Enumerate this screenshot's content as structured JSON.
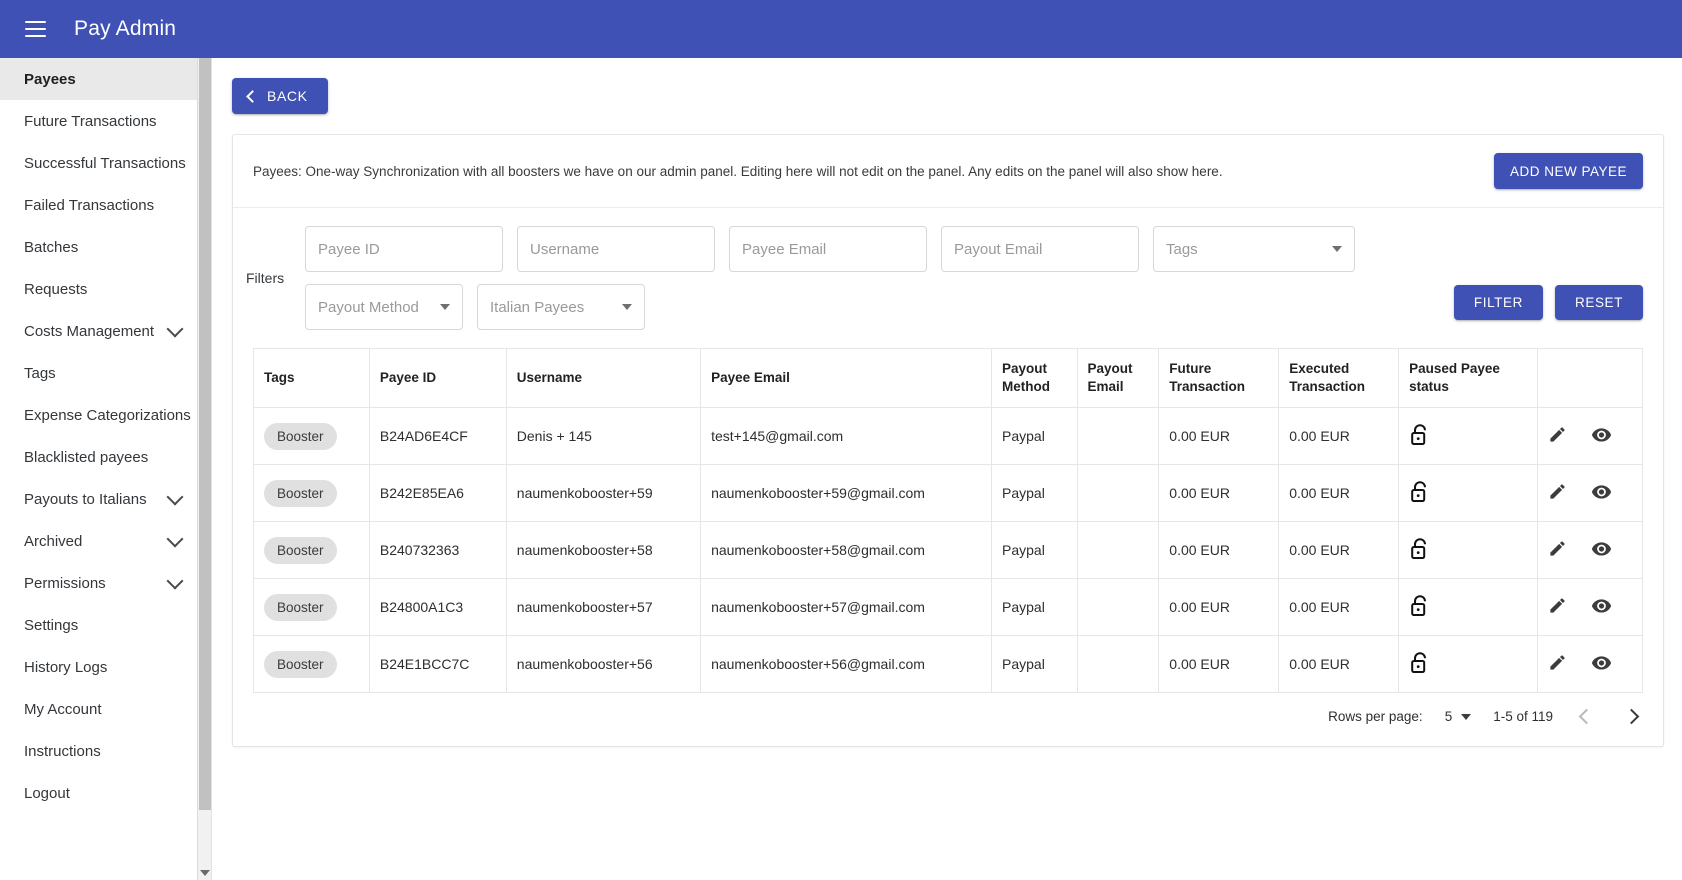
{
  "appbar": {
    "title": "Pay Admin",
    "menu_icon": "hamburger-menu-icon"
  },
  "sidebar": {
    "items": [
      {
        "label": "Payees",
        "active": true,
        "expandable": false
      },
      {
        "label": "Future Transactions",
        "active": false,
        "expandable": false
      },
      {
        "label": "Successful Transactions",
        "active": false,
        "expandable": false
      },
      {
        "label": "Failed Transactions",
        "active": false,
        "expandable": false
      },
      {
        "label": "Batches",
        "active": false,
        "expandable": false
      },
      {
        "label": "Requests",
        "active": false,
        "expandable": false
      },
      {
        "label": "Costs Management",
        "active": false,
        "expandable": true
      },
      {
        "label": "Tags",
        "active": false,
        "expandable": false
      },
      {
        "label": "Expense Categorizations",
        "active": false,
        "expandable": false
      },
      {
        "label": "Blacklisted payees",
        "active": false,
        "expandable": false
      },
      {
        "label": "Payouts to Italians",
        "active": false,
        "expandable": true
      },
      {
        "label": "Archived",
        "active": false,
        "expandable": true
      },
      {
        "label": "Permissions",
        "active": false,
        "expandable": true
      },
      {
        "label": "Settings",
        "active": false,
        "expandable": false
      },
      {
        "label": "History Logs",
        "active": false,
        "expandable": false
      },
      {
        "label": "My Account",
        "active": false,
        "expandable": false
      },
      {
        "label": "Instructions",
        "active": false,
        "expandable": false
      },
      {
        "label": "Logout",
        "active": false,
        "expandable": false
      }
    ]
  },
  "toolbar": {
    "back_label": "BACK"
  },
  "card": {
    "note": "Payees: One-way Synchronization with all boosters we have on our admin panel. Editing here will not edit on the panel. Any edits on the panel will also show here.",
    "add_payee_label": "ADD NEW PAYEE"
  },
  "filters": {
    "label": "Filters",
    "payee_id_placeholder": "Payee ID",
    "payee_id_value": "",
    "username_placeholder": "Username",
    "username_value": "",
    "payee_email_placeholder": "Payee Email",
    "payee_email_value": "",
    "payout_email_placeholder": "Payout Email",
    "payout_email_value": "",
    "tags_placeholder": "Tags",
    "tags_value": "",
    "payout_method_placeholder": "Payout Method",
    "payout_method_value": "",
    "italian_payees_placeholder": "Italian Payees",
    "italian_payees_value": "",
    "filter_label": "FILTER",
    "reset_label": "RESET"
  },
  "table": {
    "columns": [
      {
        "line1": "Tags",
        "line2": ""
      },
      {
        "line1": "Payee ID",
        "line2": ""
      },
      {
        "line1": "Username",
        "line2": ""
      },
      {
        "line1": "Payee Email",
        "line2": ""
      },
      {
        "line1": "Payout",
        "line2": "Method"
      },
      {
        "line1": "Payout",
        "line2": "Email"
      },
      {
        "line1": "Future",
        "line2": "Transaction"
      },
      {
        "line1": "Executed",
        "line2": "Transaction"
      },
      {
        "line1": "Paused Payee",
        "line2": "status"
      },
      {
        "line1": "",
        "line2": ""
      }
    ],
    "rows": [
      {
        "tag": "Booster",
        "payee_id": "B24AD6E4CF",
        "username": "Denis + 145",
        "payee_email": "test+145@gmail.com",
        "payout_method": "Paypal",
        "payout_email": "",
        "future_transaction": "0.00 EUR",
        "executed_transaction": "0.00 EUR",
        "paused_status_icon": "unlocked-padlock-icon"
      },
      {
        "tag": "Booster",
        "payee_id": "B242E85EA6",
        "username": "naumenkobooster+59",
        "payee_email": "naumenkobooster+59@gmail.com",
        "payout_method": "Paypal",
        "payout_email": "",
        "future_transaction": "0.00 EUR",
        "executed_transaction": "0.00 EUR",
        "paused_status_icon": "unlocked-padlock-icon"
      },
      {
        "tag": "Booster",
        "payee_id": "B240732363",
        "username": "naumenkobooster+58",
        "payee_email": "naumenkobooster+58@gmail.com",
        "payout_method": "Paypal",
        "payout_email": "",
        "future_transaction": "0.00 EUR",
        "executed_transaction": "0.00 EUR",
        "paused_status_icon": "unlocked-padlock-icon"
      },
      {
        "tag": "Booster",
        "payee_id": "B24800A1C3",
        "username": "naumenkobooster+57",
        "payee_email": "naumenkobooster+57@gmail.com",
        "payout_method": "Paypal",
        "payout_email": "",
        "future_transaction": "0.00 EUR",
        "executed_transaction": "0.00 EUR",
        "paused_status_icon": "unlocked-padlock-icon"
      },
      {
        "tag": "Booster",
        "payee_id": "B24E1BCC7C",
        "username": "naumenkobooster+56",
        "payee_email": "naumenkobooster+56@gmail.com",
        "payout_method": "Paypal",
        "payout_email": "",
        "future_transaction": "0.00 EUR",
        "executed_transaction": "0.00 EUR",
        "paused_status_icon": "unlocked-padlock-icon"
      }
    ],
    "row_action_icons": [
      "edit-pencil-icon",
      "view-eye-icon"
    ]
  },
  "pagination": {
    "rows_per_page_label": "Rows per page:",
    "rows_per_page_value": "5",
    "range_label": "1-5 of 119",
    "prev_icon": "chevron-left-icon",
    "next_icon": "chevron-right-icon"
  },
  "colors": {
    "primary": "#3f51b5",
    "chip_bg": "#e0e0e0",
    "sidebar_active_bg": "#e9e9e9"
  }
}
